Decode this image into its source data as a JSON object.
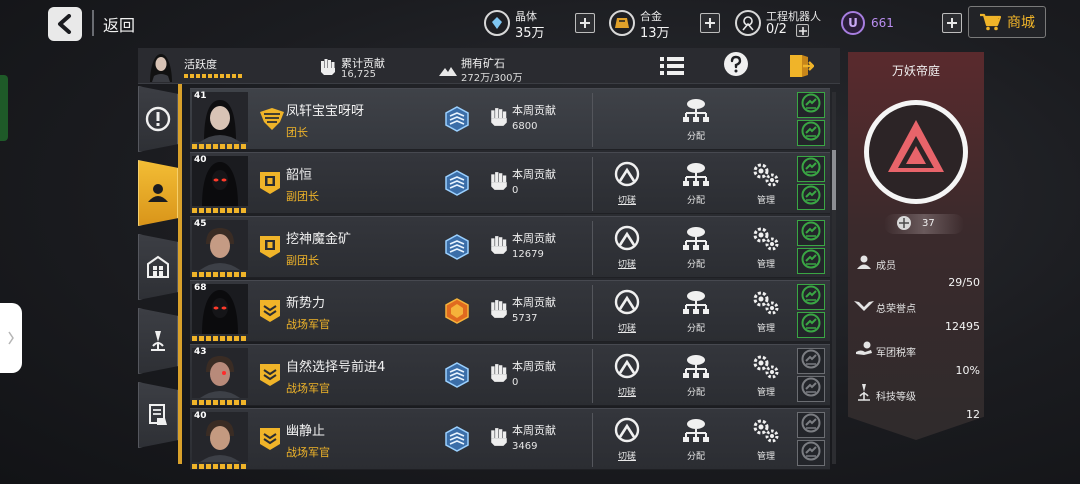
{
  "nav": {
    "back_label": "返回"
  },
  "resources": {
    "crystal": {
      "name": "晶体",
      "value": "35万"
    },
    "alloy": {
      "name": "合金",
      "value": "13万"
    },
    "robot": {
      "name": "工程机器人",
      "value": "0/2"
    },
    "premium": {
      "value": "661"
    }
  },
  "shop": {
    "label": "商城"
  },
  "stats": {
    "activity_label": "活跃度",
    "total_contribution_label": "累计贡献",
    "total_contribution_value": "16,725",
    "ore_label": "拥有矿石",
    "ore_value": "272万/300万"
  },
  "members": [
    {
      "level": "41",
      "name": "凤轩宝宝呀呀",
      "role": "团长",
      "contrib_label": "本周贡献",
      "contrib": "6800",
      "is_self": true,
      "actions": [
        "分配"
      ],
      "tech": "blue"
    },
    {
      "level": "40",
      "name": "韶恒",
      "role": "副团长",
      "contrib_label": "本周贡献",
      "contrib": "0",
      "is_self": false,
      "actions": [
        "切磋",
        "分配",
        "管理"
      ],
      "tech": "blue"
    },
    {
      "level": "45",
      "name": "挖神魔金矿",
      "role": "副团长",
      "contrib_label": "本周贡献",
      "contrib": "12679",
      "is_self": false,
      "actions": [
        "切磋",
        "分配",
        "管理"
      ],
      "tech": "blue"
    },
    {
      "level": "68",
      "name": "新势力",
      "role": "战场军官",
      "contrib_label": "本周贡献",
      "contrib": "5737",
      "is_self": false,
      "actions": [
        "切磋",
        "分配",
        "管理"
      ],
      "tech": "orange"
    },
    {
      "level": "43",
      "name": "自然选择号前进4",
      "role": "战场军官",
      "contrib_label": "本周贡献",
      "contrib": "0",
      "is_self": false,
      "actions": [
        "切磋",
        "分配",
        "管理"
      ],
      "tech": "blue"
    },
    {
      "level": "40",
      "name": "幽静止",
      "role": "战场军官",
      "contrib_label": "本周贡献",
      "contrib": "3469",
      "is_self": false,
      "actions": [
        "切磋",
        "分配",
        "管理"
      ],
      "tech": "blue"
    }
  ],
  "legion": {
    "name": "万妖帝庭",
    "level": "37",
    "members_label": "成员",
    "members_value": "29/50",
    "honor_label": "总荣誉点",
    "honor_value": "12495",
    "tax_label": "军团税率",
    "tax_value": "10%",
    "tech_label": "科技等级",
    "tech_value": "12"
  },
  "colors": {
    "accent": "#f0b429",
    "green": "#3aa644",
    "legion_red": "#e8646a"
  }
}
